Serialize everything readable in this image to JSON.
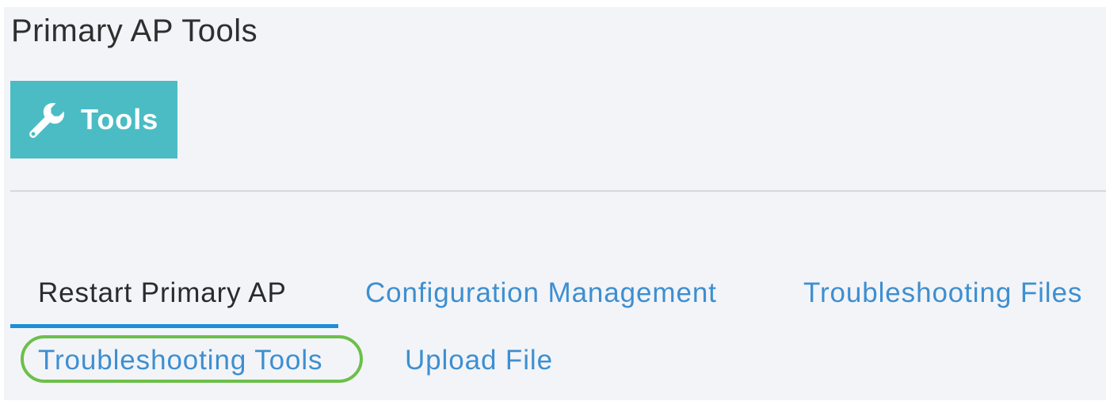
{
  "page": {
    "title": "Primary AP Tools"
  },
  "tools_button": {
    "label": "Tools",
    "icon": "wrench-icon"
  },
  "tabs": [
    {
      "label": "Restart Primary AP",
      "active": true
    },
    {
      "label": "Configuration Management",
      "active": false
    },
    {
      "label": "Troubleshooting Files",
      "active": false
    },
    {
      "label": "Troubleshooting Tools",
      "active": false,
      "highlighted": true
    },
    {
      "label": "Upload File",
      "active": false
    }
  ],
  "colors": {
    "panel_background": "#f3f4f8",
    "tools_button": "#4bbcc4",
    "tab_link": "#3d8fd1",
    "tab_active_text": "#2b2b2b",
    "active_underline": "#1c8fd6",
    "highlight_ring": "#6cc04a"
  }
}
